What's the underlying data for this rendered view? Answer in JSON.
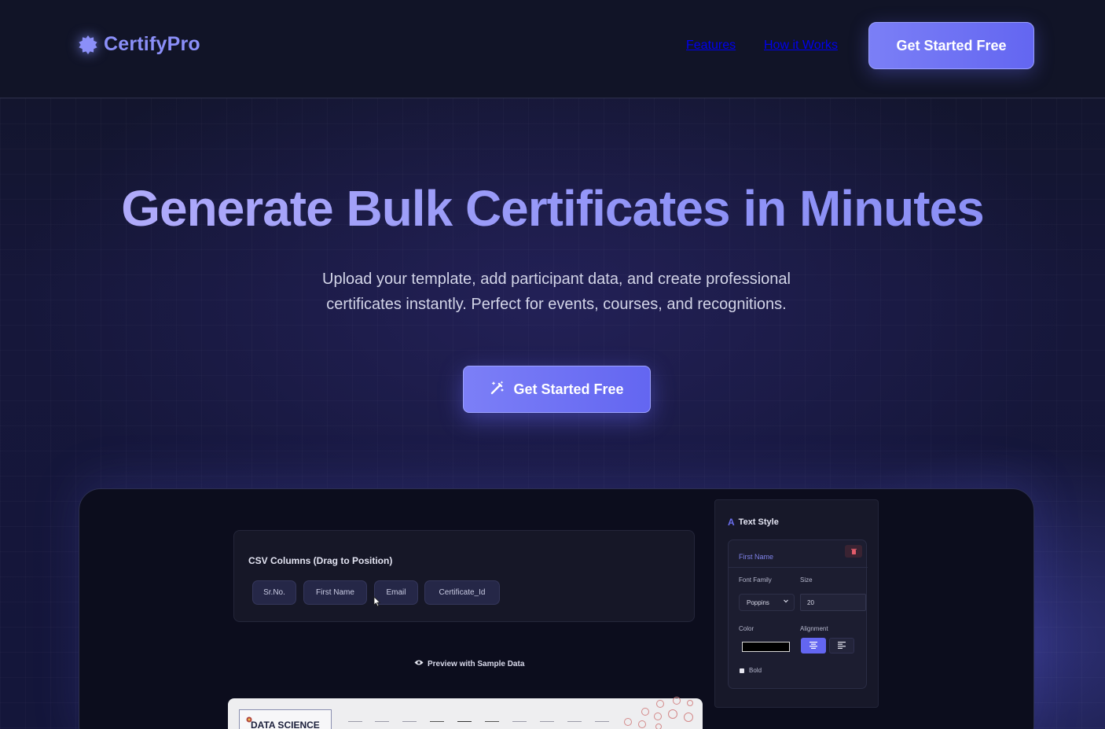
{
  "app": {
    "name": "CertifyPro"
  },
  "nav": {
    "features": "Features",
    "how_it_works": "How it Works",
    "cta": "Get Started Free"
  },
  "hero": {
    "title": "Generate Bulk Certificates in Minutes",
    "subtitle": "Upload your template, add participant data, and create professional certificates instantly. Perfect for events, courses, and recognitions.",
    "cta": "Get Started Free"
  },
  "preview": {
    "csv_panel": {
      "title": "CSV Columns (Drag to Position)",
      "columns": [
        "Sr.No.",
        "First Name",
        "Email",
        "Certificate_Id"
      ]
    },
    "preview_label": "Preview with Sample Data",
    "certificate": {
      "heading": "DATA SCIENCE"
    },
    "text_style": {
      "title": "Text Style",
      "title_icon": "A",
      "field_name": "First Name",
      "font_family_label": "Font Family",
      "font_family_value": "Poppins",
      "size_label": "Size",
      "size_value": "20",
      "color_label": "Color",
      "color_value": "#000000",
      "alignment_label": "Alignment",
      "bold_label": "Bold"
    }
  },
  "colors": {
    "accent": "#6366f1",
    "accent_light": "#8b8ff8",
    "background": "#121530",
    "panel": "#171829"
  }
}
